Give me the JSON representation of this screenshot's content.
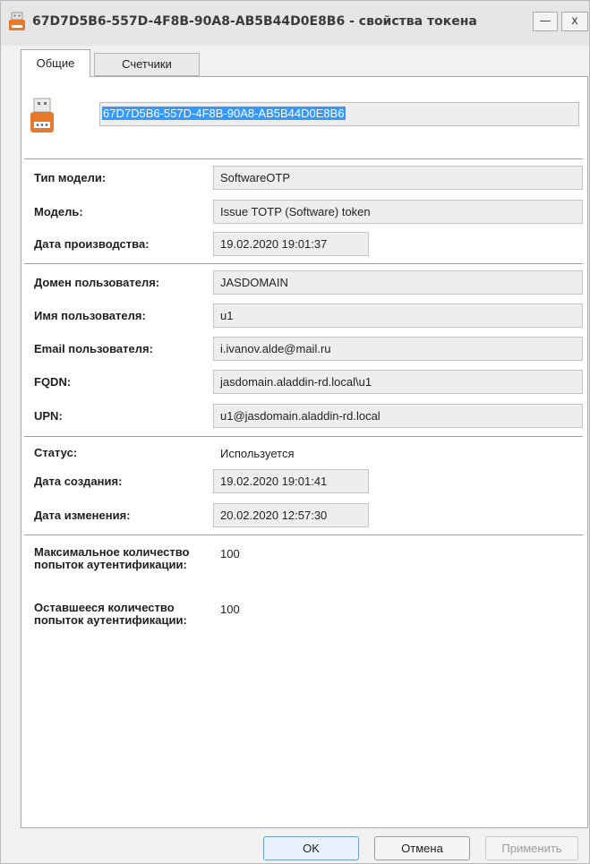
{
  "window": {
    "title": "67D7D5B6-557D-4F8B-90A8-AB5B44D0E8B6 - свойства токена",
    "minimize_label": "—",
    "close_label": "x"
  },
  "tabs": [
    {
      "label": "Общие",
      "active": true
    },
    {
      "label": "Счетчики",
      "active": false
    }
  ],
  "token": {
    "serial": "67D7D5B6-557D-4F8B-90A8-AB5B44D0E8B6",
    "icon": "usb-token-icon"
  },
  "fields": {
    "model_type": {
      "label": "Тип модели:",
      "value": "SoftwareOTP"
    },
    "model": {
      "label": "Модель:",
      "value": "Issue TOTP (Software) token"
    },
    "production_date": {
      "label": "Дата производства:",
      "value": "19.02.2020 19:01:37"
    },
    "user_domain": {
      "label": "Домен пользователя:",
      "value": "JASDOMAIN"
    },
    "user_name": {
      "label": "Имя пользователя:",
      "value": "u1"
    },
    "user_email": {
      "label": "Email пользователя:",
      "value": "i.ivanov.alde@mail.ru"
    },
    "fqdn": {
      "label": "FQDN:",
      "value": "jasdomain.aladdin-rd.local\\u1"
    },
    "upn": {
      "label": "UPN:",
      "value": "u1@jasdomain.aladdin-rd.local"
    },
    "status": {
      "label": "Статус:",
      "value": "Используется"
    },
    "created": {
      "label": "Дата создания:",
      "value": "19.02.2020 19:01:41"
    },
    "modified": {
      "label": "Дата изменения:",
      "value": "20.02.2020 12:57:30"
    },
    "max_attempts": {
      "label": "Максимальное количество попыток аутентификации:",
      "value": "100"
    },
    "remaining_attempts": {
      "label": "Оставшееся количество попыток аутентификации:",
      "value": "100"
    }
  },
  "buttons": {
    "ok": "OK",
    "cancel": "Отмена",
    "apply": "Применить"
  },
  "colors": {
    "selection": "#3399ff",
    "token_icon": "#e8792b",
    "ok_border": "#6aa0d8"
  }
}
